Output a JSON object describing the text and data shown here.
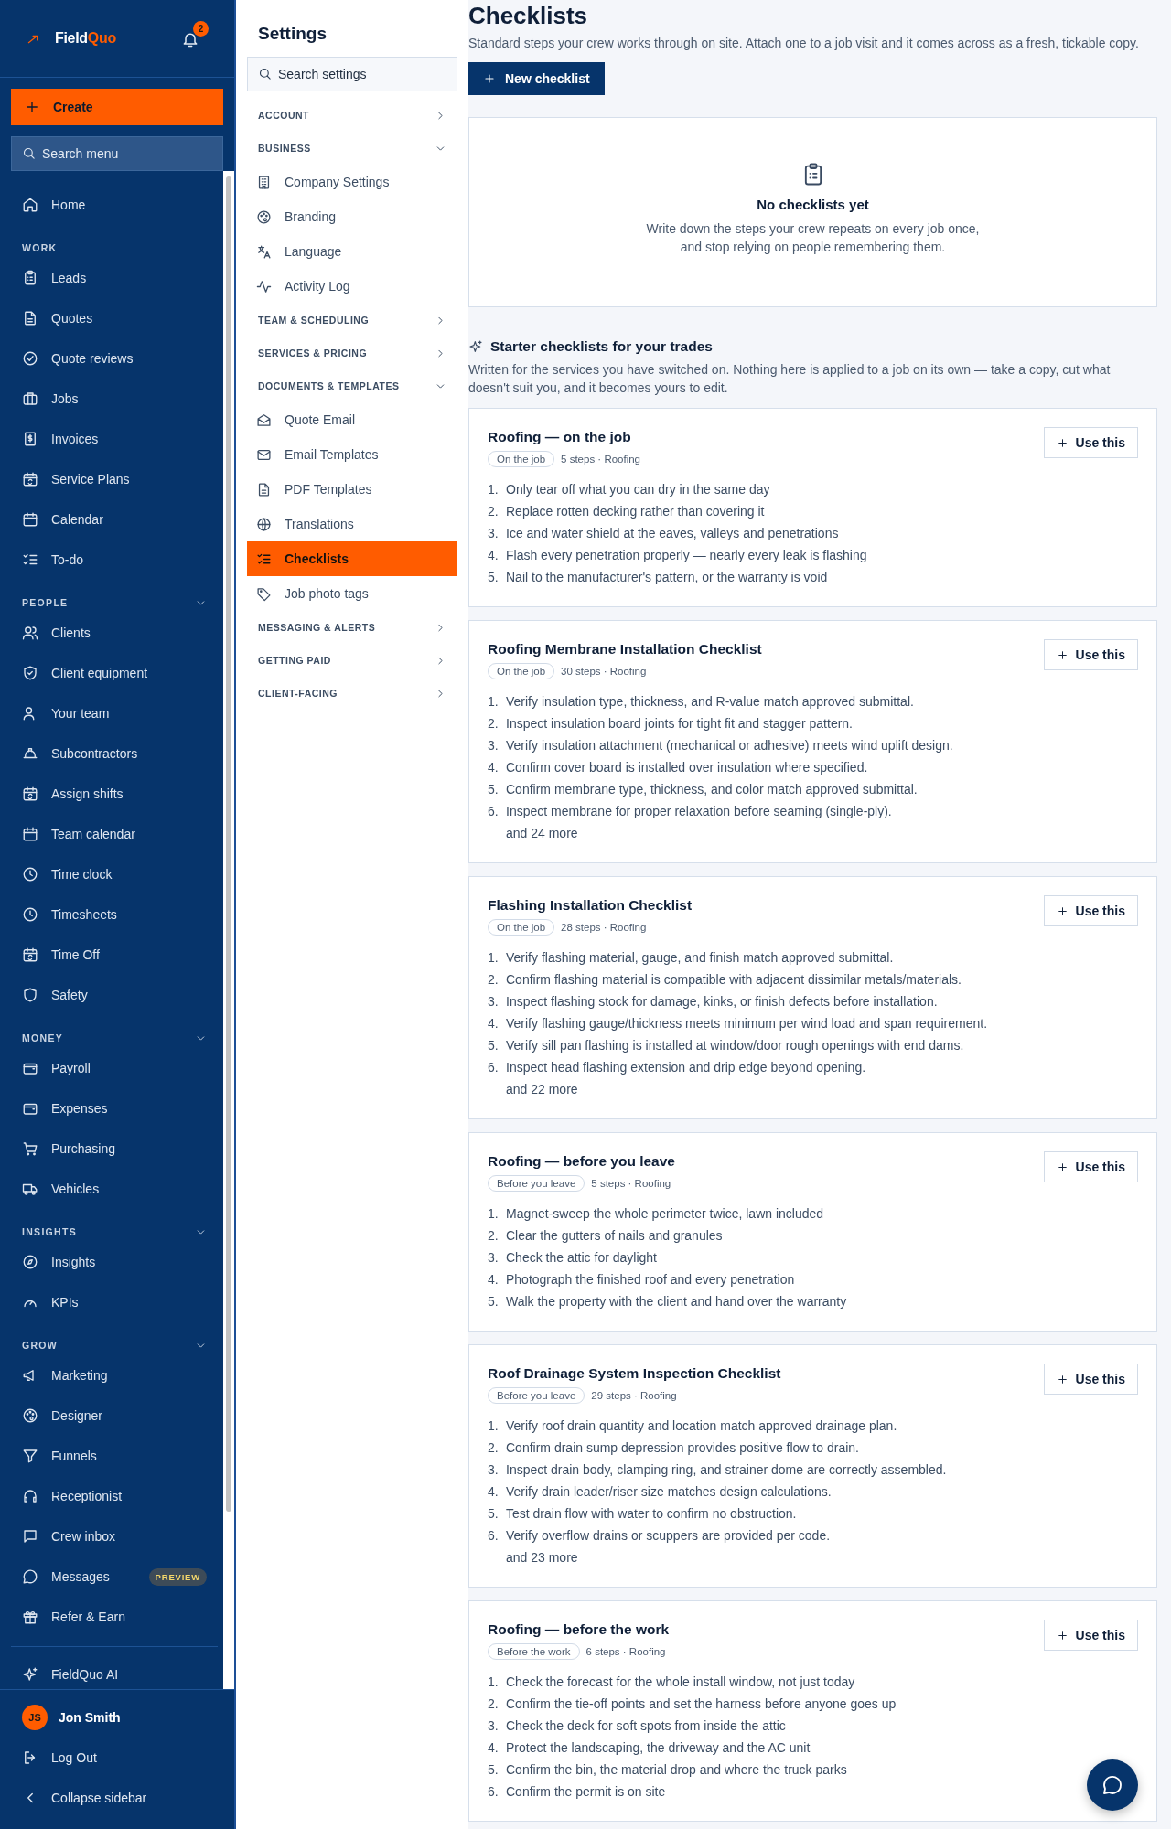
{
  "sidebar": {
    "logo": {
      "name_part": "Field",
      "accent_part": "Quo"
    },
    "notifications": {
      "count": "2"
    },
    "create_button": "Create",
    "search": {
      "placeholder": "Search menu"
    },
    "sections": [
      {
        "items": [
          {
            "label": "Home"
          }
        ]
      },
      {
        "label": "WORK",
        "items": [
          {
            "label": "Leads"
          },
          {
            "label": "Quotes"
          },
          {
            "label": "Quote reviews"
          },
          {
            "label": "Jobs"
          },
          {
            "label": "Invoices"
          },
          {
            "label": "Service Plans"
          },
          {
            "label": "Calendar"
          },
          {
            "label": "To-do"
          }
        ]
      },
      {
        "label": "PEOPLE",
        "expanded": true,
        "items": [
          {
            "label": "Clients"
          },
          {
            "label": "Client equipment"
          },
          {
            "label": "Your team"
          },
          {
            "label": "Subcontractors"
          },
          {
            "label": "Assign shifts"
          },
          {
            "label": "Team calendar"
          },
          {
            "label": "Time clock"
          },
          {
            "label": "Timesheets"
          },
          {
            "label": "Time Off"
          },
          {
            "label": "Safety"
          }
        ]
      },
      {
        "label": "MONEY",
        "expanded": true,
        "items": [
          {
            "label": "Payroll"
          },
          {
            "label": "Expenses"
          },
          {
            "label": "Purchasing"
          },
          {
            "label": "Vehicles"
          }
        ]
      },
      {
        "label": "INSIGHTS",
        "expanded": true,
        "items": [
          {
            "label": "Insights"
          },
          {
            "label": "KPIs"
          }
        ]
      },
      {
        "label": "GROW",
        "expanded": true,
        "items": [
          {
            "label": "Marketing"
          },
          {
            "label": "Designer"
          },
          {
            "label": "Funnels"
          },
          {
            "label": "Receptionist"
          },
          {
            "label": "Crew inbox"
          },
          {
            "label": "Messages",
            "badge": "PREVIEW"
          },
          {
            "label": "Refer & Earn"
          }
        ]
      }
    ],
    "footer_items": [
      {
        "label": "FieldQuo AI"
      }
    ],
    "user": {
      "initials": "JS",
      "name": "Jon Smith"
    },
    "logout": "Log Out",
    "collapse": "Collapse sidebar"
  },
  "settings": {
    "title": "Settings",
    "search": {
      "placeholder": "Search settings"
    },
    "groups": [
      {
        "label": "ACCOUNT",
        "expanded": false
      },
      {
        "label": "BUSINESS",
        "expanded": true,
        "items": [
          {
            "label": "Company Settings",
            "selected": false
          },
          {
            "label": "Branding",
            "selected": false
          },
          {
            "label": "Language",
            "selected": false
          },
          {
            "label": "Activity Log",
            "selected": false
          }
        ]
      },
      {
        "label": "TEAM & SCHEDULING",
        "expanded": false
      },
      {
        "label": "SERVICES & PRICING",
        "expanded": false
      },
      {
        "label": "DOCUMENTS & TEMPLATES",
        "expanded": true,
        "items": [
          {
            "label": "Quote Email",
            "selected": false
          },
          {
            "label": "Email Templates",
            "selected": false
          },
          {
            "label": "PDF Templates",
            "selected": false
          },
          {
            "label": "Translations",
            "selected": false
          },
          {
            "label": "Checklists",
            "selected": true
          },
          {
            "label": "Job photo tags",
            "selected": false
          }
        ]
      },
      {
        "label": "MESSAGING & ALERTS",
        "expanded": false
      },
      {
        "label": "GETTING PAID",
        "expanded": false
      },
      {
        "label": "CLIENT-FACING",
        "expanded": false
      }
    ]
  },
  "page": {
    "title": "Checklists",
    "subtitle": "Standard steps your crew works through on site. Attach one to a job visit and it comes across as a fresh, tickable copy.",
    "new_button": "New checklist",
    "empty_state": {
      "title": "No checklists yet",
      "text": "Write down the steps your crew repeats on every job once, and stop relying on people remembering them."
    },
    "starter": {
      "title": "Starter checklists for your trades",
      "text": "Written for the services you have switched on. Nothing here is applied to a job on its own — take a copy, cut what doesn't suit you, and it becomes yours to edit."
    },
    "cards": [
      {
        "title": "Roofing — on the job",
        "tag": "On the job",
        "meta": "5 steps · Roofing",
        "button": "Use this",
        "steps": [
          {
            "number": "1.",
            "text": "Only tear off what you can dry in the same day"
          },
          {
            "number": "2.",
            "text": "Replace rotten decking rather than covering it"
          },
          {
            "number": "3.",
            "text": "Ice and water shield at the eaves, valleys and penetrations"
          },
          {
            "number": "4.",
            "text": "Flash every penetration properly — nearly every leak is flashing"
          },
          {
            "number": "5.",
            "text": "Nail to the manufacturer's pattern, or the warranty is void"
          }
        ]
      },
      {
        "title": "Roofing Membrane Installation Checklist",
        "tag": "On the job",
        "meta": "30 steps · Roofing",
        "button": "Use this",
        "steps": [
          {
            "number": "1.",
            "text": "Verify insulation type, thickness, and R-value match approved submittal."
          },
          {
            "number": "2.",
            "text": "Inspect insulation board joints for tight fit and stagger pattern."
          },
          {
            "number": "3.",
            "text": "Verify insulation attachment (mechanical or adhesive) meets wind uplift design."
          },
          {
            "number": "4.",
            "text": "Confirm cover board is installed over insulation where specified."
          },
          {
            "number": "5.",
            "text": "Confirm membrane type, thickness, and color match approved submittal."
          },
          {
            "number": "6.",
            "text": "Inspect membrane for proper relaxation before seaming (single-ply)."
          }
        ],
        "more": "and 24 more"
      },
      {
        "title": "Flashing Installation Checklist",
        "tag": "On the job",
        "meta": "28 steps · Roofing",
        "button": "Use this",
        "steps": [
          {
            "number": "1.",
            "text": "Verify flashing material, gauge, and finish match approved submittal."
          },
          {
            "number": "2.",
            "text": "Confirm flashing material is compatible with adjacent dissimilar metals/materials."
          },
          {
            "number": "3.",
            "text": "Inspect flashing stock for damage, kinks, or finish defects before installation."
          },
          {
            "number": "4.",
            "text": "Verify flashing gauge/thickness meets minimum per wind load and span requirement."
          },
          {
            "number": "5.",
            "text": "Verify sill pan flashing is installed at window/door rough openings with end dams."
          },
          {
            "number": "6.",
            "text": "Inspect head flashing extension and drip edge beyond opening."
          }
        ],
        "more": "and 22 more"
      },
      {
        "title": "Roofing — before you leave",
        "tag": "Before you leave",
        "meta": "5 steps · Roofing",
        "button": "Use this",
        "steps": [
          {
            "number": "1.",
            "text": "Magnet-sweep the whole perimeter twice, lawn included"
          },
          {
            "number": "2.",
            "text": "Clear the gutters of nails and granules"
          },
          {
            "number": "3.",
            "text": "Check the attic for daylight"
          },
          {
            "number": "4.",
            "text": "Photograph the finished roof and every penetration"
          },
          {
            "number": "5.",
            "text": "Walk the property with the client and hand over the warranty"
          }
        ]
      },
      {
        "title": "Roof Drainage System Inspection Checklist",
        "tag": "Before you leave",
        "meta": "29 steps · Roofing",
        "button": "Use this",
        "steps": [
          {
            "number": "1.",
            "text": "Verify roof drain quantity and location match approved drainage plan."
          },
          {
            "number": "2.",
            "text": "Confirm drain sump depression provides positive flow to drain."
          },
          {
            "number": "3.",
            "text": "Inspect drain body, clamping ring, and strainer dome are correctly assembled."
          },
          {
            "number": "4.",
            "text": "Verify drain leader/riser size matches design calculations."
          },
          {
            "number": "5.",
            "text": "Test drain flow with water to confirm no obstruction."
          },
          {
            "number": "6.",
            "text": "Verify overflow drains or scuppers are provided per code."
          }
        ],
        "more": "and 23 more"
      },
      {
        "title": "Roofing — before the work",
        "tag": "Before the work",
        "meta": "6 steps · Roofing",
        "button": "Use this",
        "steps": [
          {
            "number": "1.",
            "text": "Check the forecast for the whole install window, not just today"
          },
          {
            "number": "2.",
            "text": "Confirm the tie-off points and set the harness before anyone goes up"
          },
          {
            "number": "3.",
            "text": "Check the deck for soft spots from inside the attic"
          },
          {
            "number": "4.",
            "text": "Protect the landscaping, the driveway and the AC unit"
          },
          {
            "number": "5.",
            "text": "Confirm the bin, the material drop and where the truck parks"
          },
          {
            "number": "6.",
            "text": "Confirm the permit is on site"
          }
        ]
      }
    ]
  }
}
